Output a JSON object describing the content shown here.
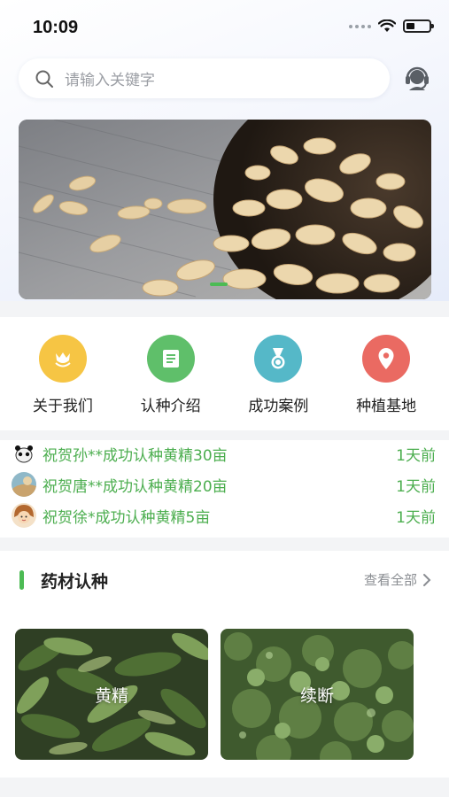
{
  "status_bar": {
    "time": "10:09"
  },
  "search": {
    "placeholder": "请输入关键字"
  },
  "menu": [
    {
      "label": "关于我们",
      "icon": "tulip-icon",
      "color": "#f6c544"
    },
    {
      "label": "认种介绍",
      "icon": "document-icon",
      "color": "#5fbf6a"
    },
    {
      "label": "成功案例",
      "icon": "medal-icon",
      "color": "#55b8c8"
    },
    {
      "label": "种植基地",
      "icon": "location-pin-icon",
      "color": "#ea6a62"
    }
  ],
  "news": [
    {
      "text": "祝贺孙**成功认种黄精30亩",
      "time": "1天前"
    },
    {
      "text": "祝贺唐**成功认种黄精20亩",
      "time": "1天前"
    },
    {
      "text": "祝贺徐*成功认种黄精5亩",
      "time": "1天前"
    }
  ],
  "section": {
    "title": "药材认种",
    "view_all": "查看全部"
  },
  "herbs": [
    {
      "name": "黄精"
    },
    {
      "name": "续断"
    }
  ],
  "colors": {
    "accent": "#4cbb54",
    "news_text": "#4cae4f"
  }
}
